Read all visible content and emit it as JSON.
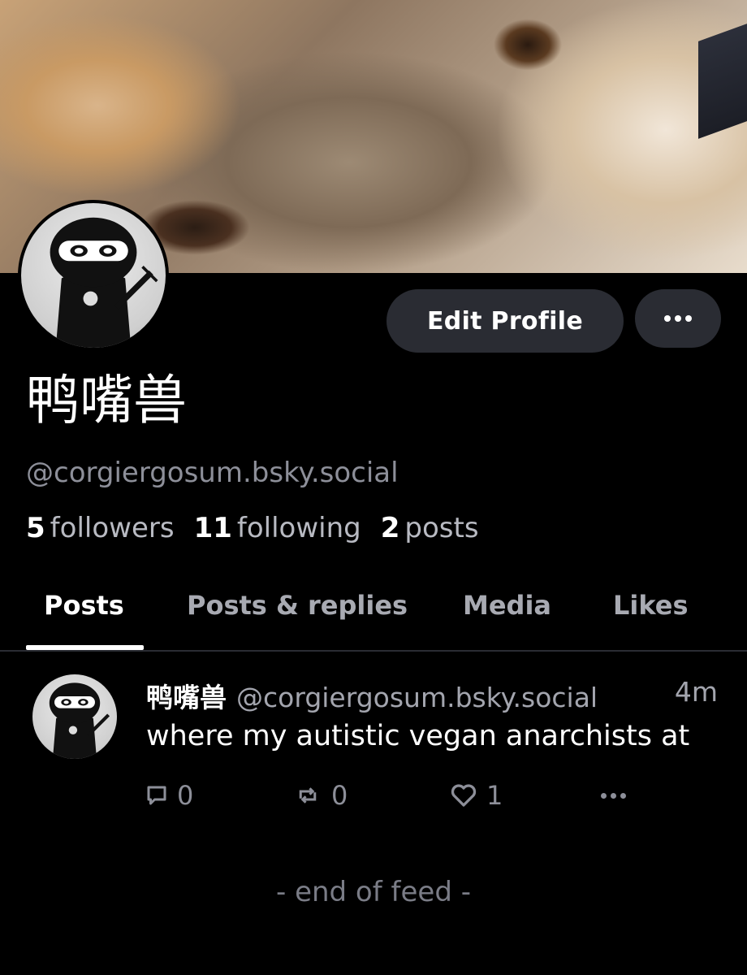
{
  "profile": {
    "display_name": "鸭嘴兽",
    "handle": "@corgiergosum.bsky.social",
    "stats": {
      "followers_count": "5",
      "followers_label": "followers",
      "following_count": "11",
      "following_label": "following",
      "posts_count": "2",
      "posts_label": "posts"
    },
    "edit_button_label": "Edit Profile"
  },
  "tabs": [
    {
      "label": "Posts",
      "active": true
    },
    {
      "label": "Posts & replies",
      "active": false
    },
    {
      "label": "Media",
      "active": false
    },
    {
      "label": "Likes",
      "active": false
    }
  ],
  "feed": {
    "posts": [
      {
        "author_name": "鸭嘴兽",
        "author_handle": "@corgiergosum.bsky.social",
        "time": "4m",
        "text": "where my autistic vegan anarchists at",
        "reply_count": "0",
        "repost_count": "0",
        "like_count": "1"
      }
    ],
    "end_label": "- end of feed -"
  },
  "icons": {
    "more": "more-horizontal-icon",
    "reply": "speech-bubble-icon",
    "repost": "repost-arrows-icon",
    "like": "heart-icon"
  },
  "colors": {
    "background": "#000000",
    "button_bg": "#2a2c33",
    "muted_text": "#8d8f99"
  }
}
